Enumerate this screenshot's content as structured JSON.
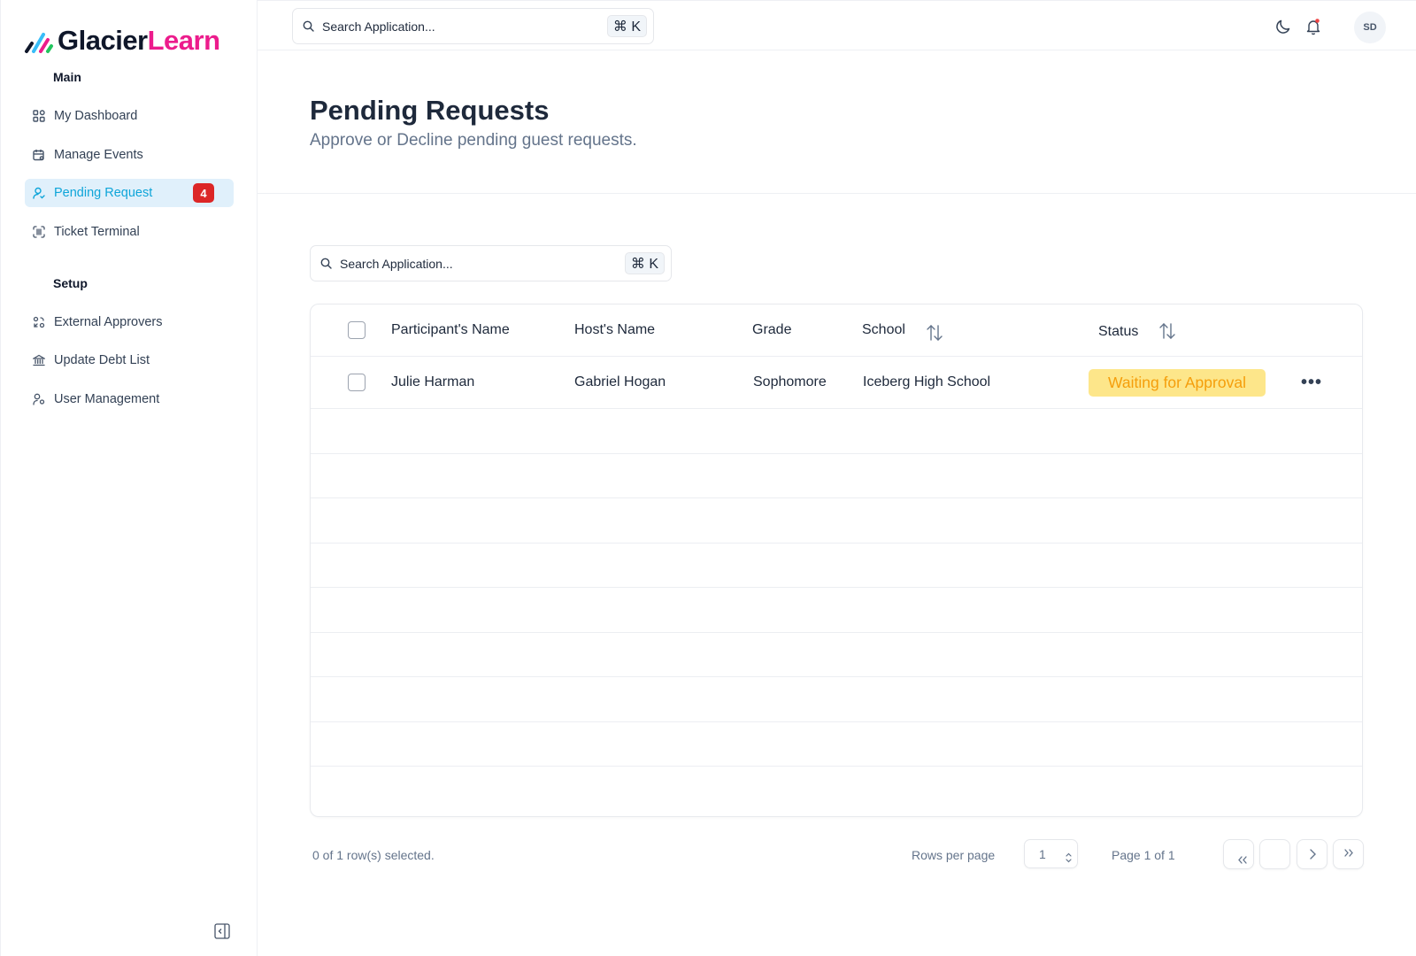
{
  "app": {
    "brand_part1": "Glacier",
    "brand_part2": "Learn",
    "brand_colors": {
      "primary": "#0f172a",
      "accent": "#ec1c8c"
    }
  },
  "sidebar": {
    "sections": [
      {
        "title": "Main",
        "items": [
          {
            "label": "My Dashboard",
            "icon": "dashboard-grid-icon",
            "active": false
          },
          {
            "label": "Manage Events",
            "icon": "calendar-search-icon",
            "active": false
          },
          {
            "label": "Pending Request",
            "icon": "user-check-icon",
            "active": true,
            "badge": "4"
          },
          {
            "label": "Ticket Terminal",
            "icon": "scan-barcode-icon",
            "active": false
          }
        ]
      },
      {
        "title": "Setup",
        "items": [
          {
            "label": "External Approvers",
            "icon": "users-exchange-icon",
            "active": false
          },
          {
            "label": "Update Debt List",
            "icon": "bank-icon",
            "active": false
          },
          {
            "label": "User Management",
            "icon": "user-settings-icon",
            "active": false
          }
        ]
      }
    ],
    "collapse_icon": "panel-collapse-icon"
  },
  "topbar": {
    "search_placeholder": "Search Application...",
    "shortcut": "⌘ K",
    "theme_icon": "moon-icon",
    "notification_icon": "bell-icon",
    "avatar_initials": "SD"
  },
  "page": {
    "title": "Pending Requests",
    "subtitle": "Approve or Decline pending guest requests."
  },
  "table_search": {
    "placeholder": "Search Application...",
    "shortcut": "⌘ K"
  },
  "table": {
    "columns": [
      "Participant's Name",
      "Host's Name",
      "Grade",
      "School",
      "Status"
    ],
    "rows": [
      {
        "participant": "Julie Harman",
        "host": "Gabriel Hogan",
        "grade": "Sophomore",
        "school": "Iceberg High School",
        "status": "Waiting for Approval",
        "status_bg": "#fde68a",
        "status_fg": "#f59e0b"
      }
    ],
    "more_label": "•••"
  },
  "footer": {
    "selection": "0 of 1 row(s) selected.",
    "rows_per_page_label": "Rows per page",
    "rows_per_page_value": "1",
    "page_info": "Page 1 of 1"
  }
}
